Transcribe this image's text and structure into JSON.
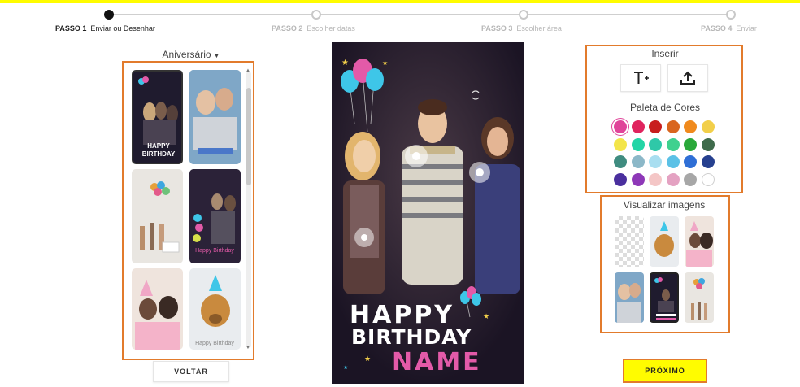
{
  "steps": [
    {
      "num": "PASSO 1",
      "label": "Enviar ou Desenhar"
    },
    {
      "num": "PASSO 2",
      "label": "Escolher datas"
    },
    {
      "num": "PASSO 3",
      "label": "Escolher área"
    },
    {
      "num": "PASSO 4",
      "label": "Enviar"
    }
  ],
  "category": {
    "label": "Aniversário"
  },
  "left_thumbnails": [
    {
      "name": "happy-birthday-friends",
      "text": "HAPPY BIRTHDAY"
    },
    {
      "name": "selfie-couple",
      "text": "happy birthday"
    },
    {
      "name": "balloons-confetti",
      "text": ""
    },
    {
      "name": "sparkler-party",
      "text": "Happy Birthday"
    },
    {
      "name": "girl-party-hat",
      "text": ""
    },
    {
      "name": "dog-party-hat",
      "text": "Happy Birthday"
    }
  ],
  "buttons": {
    "back": "VOLTAR",
    "next": "PRÓXIMO"
  },
  "preview": {
    "line1": "HAPPY",
    "line2": "BIRTHDAY",
    "line3": "NAME"
  },
  "insert": {
    "title": "Inserir",
    "add_text_icon": "text-add-icon",
    "upload_icon": "upload-icon"
  },
  "palette": {
    "title": "Paleta de Cores",
    "selected": "#e0449a",
    "colors": [
      "#e0449a",
      "#e0245e",
      "#c81e1e",
      "#d9661f",
      "#f08a1d",
      "#f2cf4a",
      "#f3e54a",
      "#23d5a6",
      "#2fc8a8",
      "#3fd18f",
      "#2aa83a",
      "#3f6b4c",
      "#3f8c80",
      "#8cb8c8",
      "#a9def0",
      "#5bc1e6",
      "#2f6fd6",
      "#26408f",
      "#4a2f9e",
      "#8e38b8",
      "#f4c6c6",
      "#e4a2c2",
      "#a7a7a7",
      "#ffffff"
    ]
  },
  "visualize": {
    "title": "Visualizar imagens"
  }
}
